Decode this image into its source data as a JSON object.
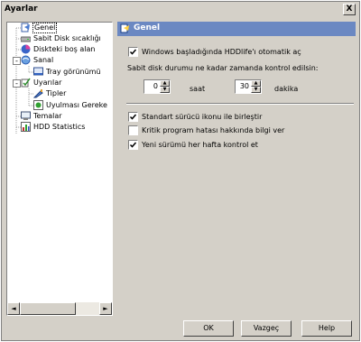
{
  "window": {
    "title": "Ayarlar",
    "close_label": "X"
  },
  "tree": {
    "items": [
      {
        "label": "Genel",
        "icon": "general-icon",
        "selected": true
      },
      {
        "label": "Sabit Disk sıcaklığı",
        "icon": "hard-disk-icon"
      },
      {
        "label": "Diskteki boş alan",
        "icon": "disk-space-icon"
      },
      {
        "label": "Sanal",
        "icon": "virtual-icon",
        "expander": "-"
      },
      {
        "label": "Tray görünümü",
        "icon": "tray-view-icon"
      },
      {
        "label": "Uyarılar",
        "icon": "warnings-icon",
        "expander": "-"
      },
      {
        "label": "Tipler",
        "icon": "types-icon"
      },
      {
        "label": "Uyulması Gereke",
        "icon": "required-rules-icon"
      },
      {
        "label": "Temalar",
        "icon": "themes-icon"
      },
      {
        "label": "HDD Statistics",
        "icon": "statistics-icon"
      }
    ],
    "scroll_left": "◄",
    "scroll_right": "►"
  },
  "panel": {
    "title": "Genel",
    "autostart_label": "Windows başladığında HDDlife'ı otomatik aç",
    "autostart_checked": true,
    "check_interval_label": "Sabit disk durumu ne kadar zamanda kontrol edilsin:",
    "hours_value": "0",
    "hours_label": "saat",
    "minutes_value": "30",
    "minutes_label": "dakika",
    "standard_icon_label": "Standart sürücü ikonu ile birleştir",
    "standard_icon_checked": true,
    "critical_info_label": "Kritik program hatası hakkında bilgi ver",
    "critical_info_checked": false,
    "weekly_update_label": "Yeni sürümü her hafta kontrol et",
    "weekly_update_checked": true
  },
  "buttons": {
    "ok": "OK",
    "cancel": "Vazgeç",
    "help": "Help"
  },
  "colors": {
    "header_bg": "#6b88c2",
    "window_bg": "#d4d0c8"
  }
}
